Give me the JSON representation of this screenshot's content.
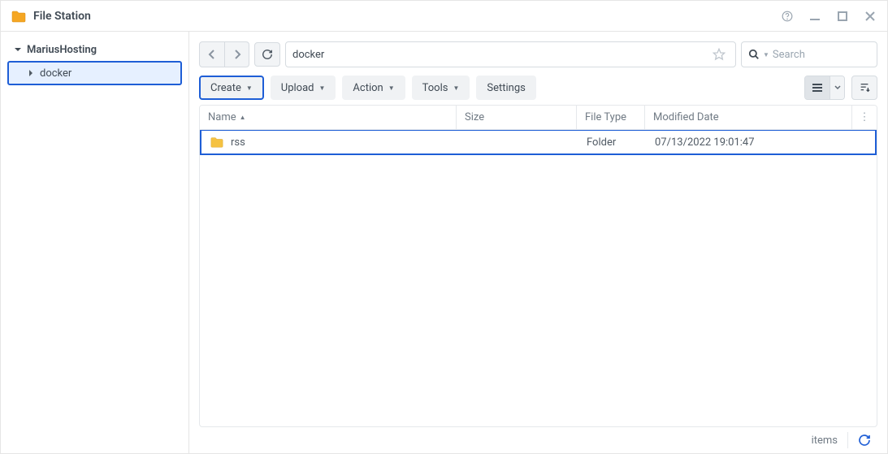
{
  "window": {
    "title": "File Station"
  },
  "sidebar": {
    "root": "MariusHosting",
    "selected": "docker"
  },
  "path": {
    "value": "docker"
  },
  "search": {
    "placeholder": "Search"
  },
  "toolbar": {
    "create": "Create",
    "upload": "Upload",
    "action": "Action",
    "tools": "Tools",
    "settings": "Settings"
  },
  "columns": {
    "name": "Name",
    "size": "Size",
    "type": "File Type",
    "modified": "Modified Date"
  },
  "rows": [
    {
      "name": "rss",
      "size": "",
      "type": "Folder",
      "modified": "07/13/2022 19:01:47"
    }
  ],
  "footer": {
    "items_label": "items"
  }
}
